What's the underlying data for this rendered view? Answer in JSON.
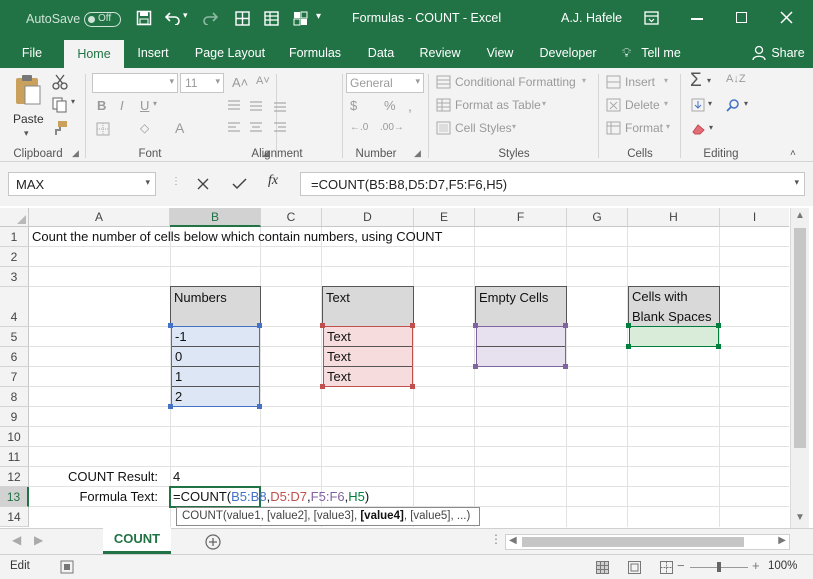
{
  "title_bar": {
    "autosave_label": "AutoSave",
    "autosave_state": "Off",
    "document_title": "Formulas - COUNT  -  Excel",
    "user_name": "A.J. Hafele"
  },
  "ribbon_tabs": [
    "File",
    "Home",
    "Insert",
    "Page Layout",
    "Formulas",
    "Data",
    "Review",
    "View",
    "Developer",
    "Tell me",
    "Share"
  ],
  "ribbon": {
    "paste_label": "Paste",
    "font_size": "11",
    "number_format": "General",
    "conditional_formatting": "Conditional Formatting",
    "format_as_table": "Format as Table",
    "cell_styles": "Cell Styles",
    "insert": "Insert",
    "delete": "Delete",
    "format": "Format",
    "groups": [
      "Clipboard",
      "Font",
      "Alignment",
      "Number",
      "Styles",
      "Cells",
      "Editing"
    ]
  },
  "formula_bar": {
    "name_box": "MAX",
    "formula": "=COUNT(B5:B8,D5:D7,F5:F6,H5)"
  },
  "columns": [
    "A",
    "B",
    "C",
    "D",
    "E",
    "F",
    "G",
    "H",
    "I"
  ],
  "rows": [
    "1",
    "2",
    "3",
    "4",
    "5",
    "6",
    "7",
    "8",
    "9",
    "10",
    "11",
    "12",
    "13",
    "14"
  ],
  "cells": {
    "a1": "Count the number of cells below which contain numbers, using COUNT",
    "b4": "Numbers",
    "d4": "Text",
    "f4": "Empty Cells",
    "h4_line1": "Cells with",
    "h4_line2": "Blank Spaces",
    "b5": "-1",
    "b6": "0",
    "b7": "1",
    "b8": "2",
    "d5": "Text",
    "d6": "Text",
    "d7": "Text",
    "a12": "COUNT Result:",
    "b12": "4",
    "a13": "Formula Text:"
  },
  "edit_formula": {
    "prefix": "=COUNT(",
    "ref1": "B5:B8",
    "ref2": "D5:D7",
    "ref3": "F5:F6",
    "ref4": "H5",
    "suffix": ")"
  },
  "tooltip": {
    "fn": "COUNT(value1, [value2], [value3], ",
    "bold": "[value4]",
    "rest": ", [value5], ...)"
  },
  "sheet_tab": "COUNT",
  "status": {
    "mode": "Edit",
    "zoom": "100%"
  },
  "colors": {
    "excel_green": "#217346",
    "ref_blue": "#4472c4",
    "ref_red": "#c0504d",
    "ref_purple": "#8064a2",
    "ref_green": "#00803c",
    "header_gray": "#d9d9d9",
    "fill_blue": "#dce6f4",
    "fill_red": "#f6dcdc",
    "fill_purple": "#e6e0ef",
    "fill_green": "#d8ecd9"
  }
}
